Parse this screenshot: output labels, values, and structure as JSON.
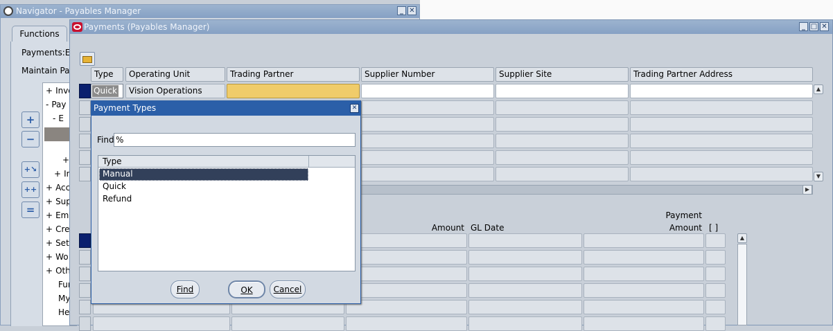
{
  "navigator": {
    "title": "Navigator - Payables Manager",
    "tab_functions": "Functions",
    "label_payments": "Payments:E",
    "label_maintain": "Maintain Pa",
    "tree": [
      {
        "prefix": "+",
        "label": "Invo"
      },
      {
        "prefix": "-",
        "label": "Pay"
      },
      {
        "prefix": "-",
        "label": "E"
      },
      {
        "prefix": "+",
        "label": ""
      },
      {
        "prefix": "+",
        "label": "In"
      },
      {
        "prefix": "+",
        "label": "Acc"
      },
      {
        "prefix": "+",
        "label": "Sup"
      },
      {
        "prefix": "+",
        "label": "Em"
      },
      {
        "prefix": "+",
        "label": "Cre"
      },
      {
        "prefix": "+",
        "label": "Set"
      },
      {
        "prefix": "+",
        "label": "Wo"
      },
      {
        "prefix": "+",
        "label": "Oth"
      },
      {
        "prefix": "",
        "label": "Fur"
      },
      {
        "prefix": "",
        "label": "My"
      },
      {
        "prefix": "",
        "label": "Hel"
      }
    ]
  },
  "payments": {
    "title": "Payments (Payables Manager)",
    "columns": [
      "Type",
      "Operating Unit",
      "Trading Partner",
      "Supplier Number",
      "Supplier Site",
      "Trading Partner Address"
    ],
    "row1": {
      "type": "Quick",
      "operating_unit": "Vision Operations"
    },
    "lower_headers": {
      "amount": "Amount",
      "gl_date": "GL Date",
      "payment_amount_line1": "Payment",
      "payment_amount_line2": "Amount",
      "bracket": "[ ]"
    }
  },
  "dialog": {
    "title": "Payment Types",
    "find_label": "Find",
    "find_value": "%",
    "list_header": "Type",
    "options": [
      "Manual",
      "Quick",
      "Refund"
    ],
    "selected": "Manual",
    "buttons": {
      "find": "Find",
      "ok": "OK",
      "cancel": "Cancel"
    }
  },
  "colors": {
    "accent_row": "#0a1f6e",
    "highlight_field": "#f0cc6a",
    "dialog_title": "#2b5fa8"
  }
}
